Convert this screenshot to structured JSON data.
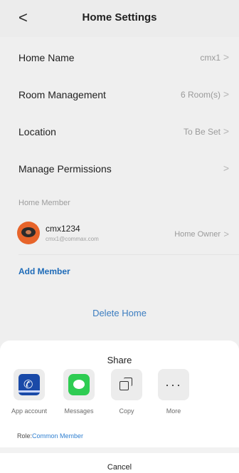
{
  "header": {
    "title": "Home Settings",
    "back_glyph": "<"
  },
  "settings": {
    "home_name": {
      "label": "Home Name",
      "value": "cmx1"
    },
    "room_management": {
      "label": "Room Management",
      "value": "6 Room(s)"
    },
    "location": {
      "label": "Location",
      "value": "To Be Set"
    },
    "manage_permissions": {
      "label": "Manage Permissions",
      "value": ""
    }
  },
  "members_section": {
    "label": "Home Member",
    "members": [
      {
        "name": "cmx1234",
        "email": "cmx1@commax.com",
        "role": "Home Owner"
      }
    ],
    "add_label": "Add Member"
  },
  "delete_label": "Delete Home",
  "share_sheet": {
    "title": "Share",
    "options": [
      {
        "label": "App account",
        "icon": "app-account-icon"
      },
      {
        "label": "Messages",
        "icon": "messages-icon"
      },
      {
        "label": "Copy",
        "icon": "copy-icon"
      },
      {
        "label": "More",
        "icon": "more-icon"
      }
    ],
    "role_key": "Role:",
    "role_value": "Common Member",
    "cancel_label": "Cancel"
  },
  "colors": {
    "accent": "#1e6bb8",
    "link": "#2f7fd0",
    "messages_green": "#2ecc52",
    "avatar_orange": "#e7642a"
  }
}
